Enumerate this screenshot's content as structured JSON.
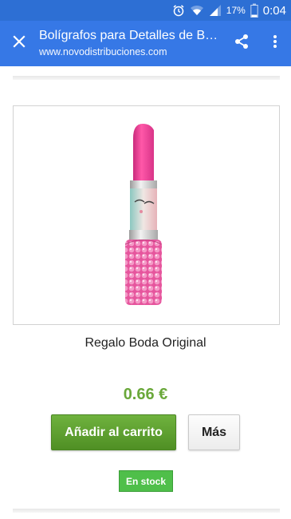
{
  "status_bar": {
    "battery_percent": "17%",
    "time": "0:04",
    "icons": [
      "alarm-icon",
      "wifi-icon",
      "signal-icon",
      "battery-icon"
    ]
  },
  "toolbar": {
    "title": "Bolígrafos para Detalles de Boda",
    "url": "www.novodistribuciones.com",
    "icons": [
      "close-icon",
      "share-icon",
      "more-vert-icon"
    ]
  },
  "product": {
    "name": "Regalo Boda Original",
    "price": "0.66 €",
    "add_to_cart_label": "Añadir al carrito",
    "more_label": "Más",
    "stock_label": "En stock",
    "image_icon": "pink-lipstick-pen-image"
  },
  "colors": {
    "status_bar": "#2d6fd4",
    "toolbar": "#3678e6",
    "price": "#6aa83a",
    "cart_button": "#5a9e2e",
    "stock_badge": "#4fbf4a"
  }
}
